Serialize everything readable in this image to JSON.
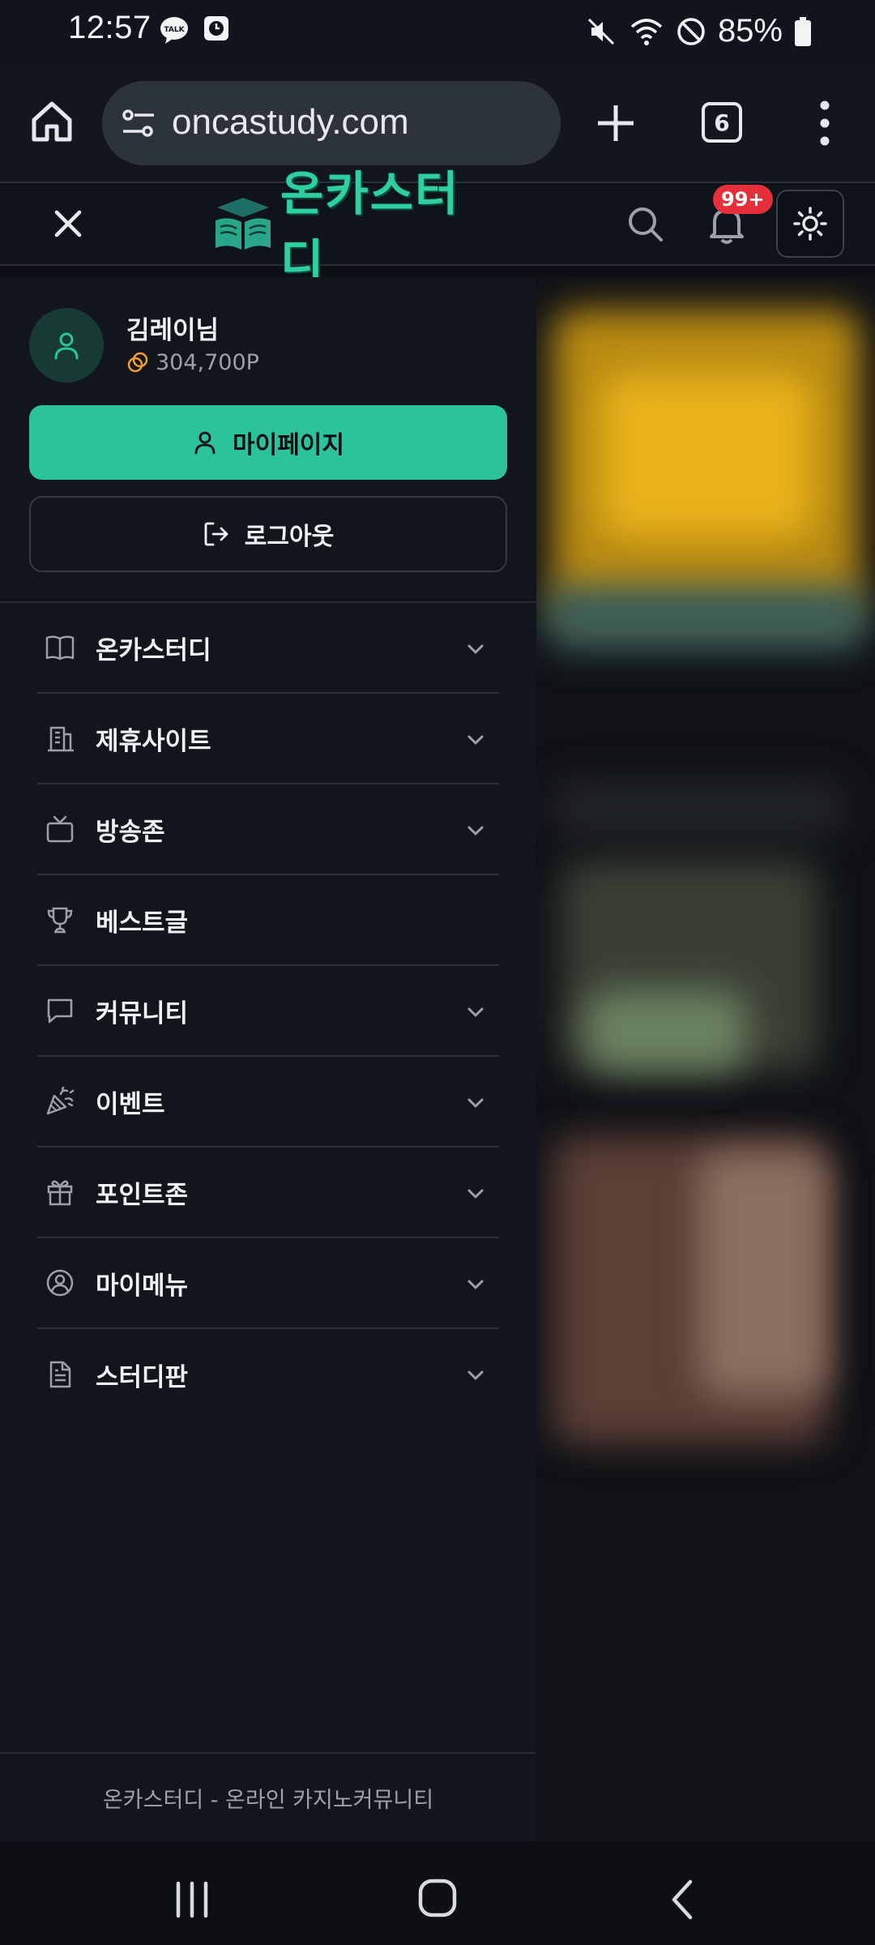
{
  "status_bar": {
    "time": "12:57",
    "battery_percent": "85%",
    "left_icons": [
      "talk-icon",
      "clock-app-icon"
    ],
    "right_icons": [
      "mute-icon",
      "wifi-icon",
      "dnd-icon",
      "battery-icon"
    ]
  },
  "browser": {
    "url": "oncastudy.com",
    "tab_count": "6",
    "icons": [
      "home-icon",
      "tune-icon",
      "new-tab-icon",
      "tab-switcher-icon",
      "more-icon"
    ]
  },
  "site_header": {
    "logo_text": "온카스터디",
    "notification_badge": "99+",
    "icons": [
      "close-icon",
      "search-icon",
      "bell-icon",
      "sun-icon"
    ]
  },
  "profile": {
    "name": "김레이님",
    "points": "304,700P"
  },
  "buttons": {
    "mypage_label": "마이페이지",
    "logout_label": "로그아웃"
  },
  "menu": {
    "items": [
      {
        "label": "온카스터디",
        "icon": "book-icon",
        "expandable": true
      },
      {
        "label": "제휴사이트",
        "icon": "building-icon",
        "expandable": true
      },
      {
        "label": "방송존",
        "icon": "tv-icon",
        "expandable": true
      },
      {
        "label": "베스트글",
        "icon": "trophy-icon",
        "expandable": false
      },
      {
        "label": "커뮤니티",
        "icon": "chat-icon",
        "expandable": true
      },
      {
        "label": "이벤트",
        "icon": "party-icon",
        "expandable": true
      },
      {
        "label": "포인트존",
        "icon": "gift-icon",
        "expandable": true
      },
      {
        "label": "마이메뉴",
        "icon": "user-circle-icon",
        "expandable": true
      },
      {
        "label": "스터디판",
        "icon": "document-icon",
        "expandable": true
      }
    ]
  },
  "footer": {
    "text": "온카스터디 - 온라인 카지노커뮤니티"
  },
  "colors": {
    "accent": "#2cc39a",
    "badge": "#e5303b",
    "background": "#12151b"
  }
}
